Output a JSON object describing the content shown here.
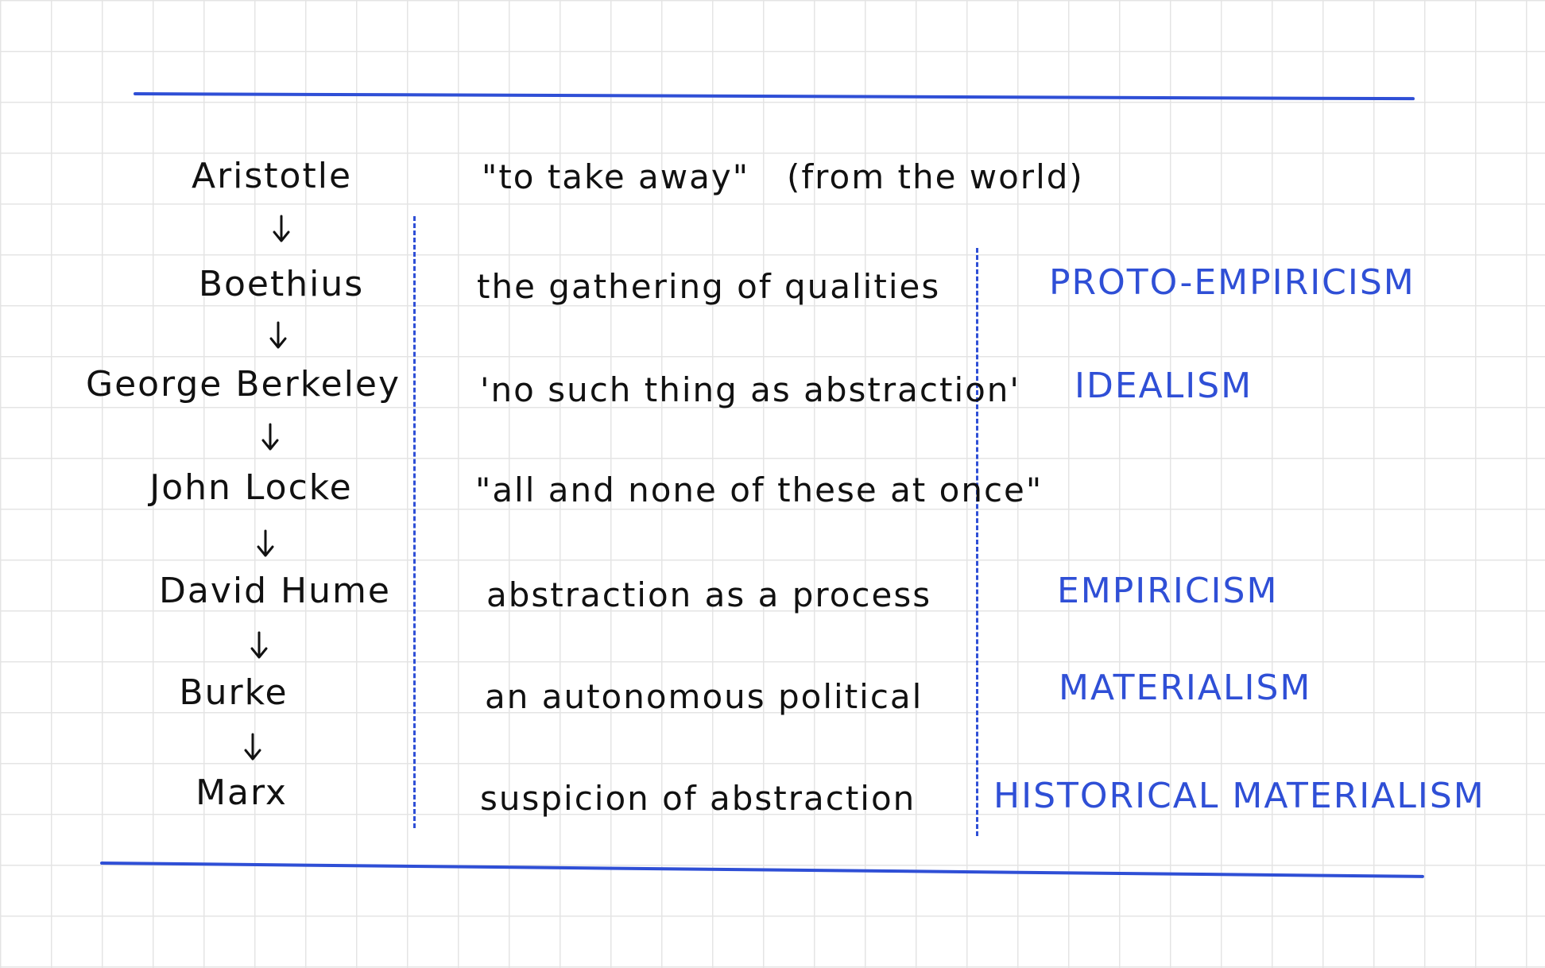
{
  "names": [
    "Aristotle",
    "Boethius",
    "George Berkeley",
    "John Locke",
    "David Hume",
    "Burke",
    "Marx"
  ],
  "notes": {
    "row1": "\"to take away\"",
    "row1_aside": "(from the world)",
    "row2": "the gathering of qualities",
    "row3": "'no such thing as abstraction'",
    "row4": "\"all and none of these at once\"",
    "row5": "abstraction as a process",
    "row6": "an autonomous political",
    "row7": "suspicion of abstraction"
  },
  "labels": {
    "row2": "PROTO-EMPIRICISM",
    "row3": "IDEALISM",
    "row5": "EMPIRICISM",
    "row6": "MATERIALISM",
    "row7": "HISTORICAL MATERIALISM"
  },
  "colors": {
    "ink": "#111111",
    "pen_blue": "#2f4fd6",
    "grid": "#e4e4e4"
  },
  "icons": [
    "down-arrow-icon"
  ]
}
